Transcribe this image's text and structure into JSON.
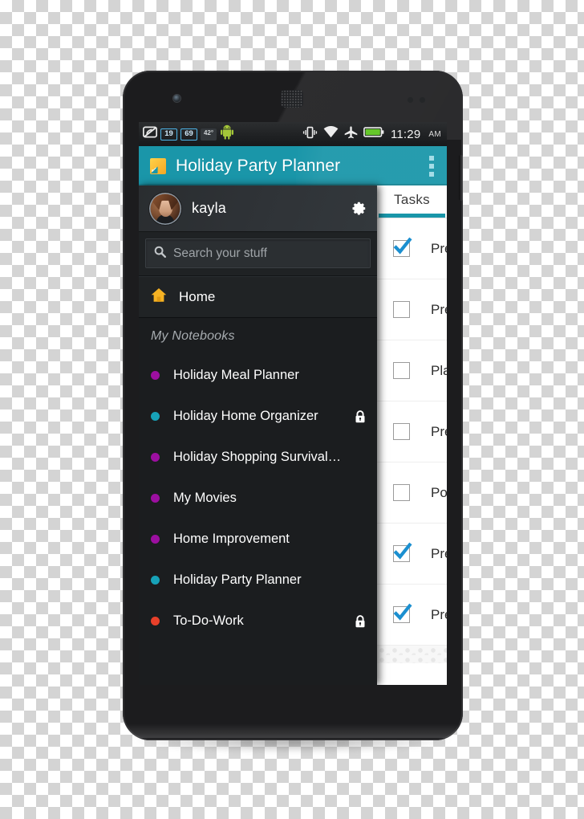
{
  "statusbar": {
    "icons": [
      "vpn-key-icon",
      "signal-badge-19",
      "signal-badge-69",
      "temperature-icon",
      "android-robot-icon",
      "vibrate-icon",
      "wifi-icon",
      "airplane-mode-icon",
      "battery-icon"
    ],
    "badge_19": "19",
    "badge_69": "69",
    "temperature": "42°",
    "time": "11:29",
    "ampm": "AM"
  },
  "appbar": {
    "app_icon": "evernote-notebook-icon",
    "title": "Holiday Party Planner",
    "overflow_label": "overflow-menu"
  },
  "drawer": {
    "account": {
      "avatar": "user-avatar",
      "username": "kayla",
      "settings_icon": "gear-icon"
    },
    "search": {
      "icon": "search-icon",
      "value": "",
      "placeholder": "Search your stuff"
    },
    "home": {
      "icon": "home-icon",
      "label": "Home"
    },
    "section_title": "My Notebooks",
    "notebooks": [
      {
        "label": "Holiday Meal Planner",
        "color": "#9c0fa0",
        "locked": false
      },
      {
        "label": "Holiday Home Organizer",
        "color": "#17a2b8",
        "locked": true
      },
      {
        "label": "Holiday Shopping Survival…",
        "color": "#9c0fa0",
        "locked": false
      },
      {
        "label": "My Movies",
        "color": "#9c0fa0",
        "locked": false
      },
      {
        "label": "Home Improvement",
        "color": "#9c0fa0",
        "locked": false
      },
      {
        "label": "Holiday Party Planner",
        "color": "#17a2b8",
        "locked": false
      },
      {
        "label": "To-Do-Work",
        "color": "#e8402a",
        "locked": true
      }
    ]
  },
  "content": {
    "tab": "Tasks",
    "tasks": [
      {
        "text": "Prep",
        "checked": true
      },
      {
        "text": "Prep",
        "checked": false
      },
      {
        "text": "Plan",
        "checked": false
      },
      {
        "text": "Prep",
        "checked": false
      },
      {
        "text": "Post",
        "checked": false
      },
      {
        "text": "Prep",
        "checked": true
      },
      {
        "text": "Prep",
        "checked": true
      }
    ]
  },
  "colors": {
    "accent_teal": "#1a96a9",
    "drawer_bg": "#1b1d1f",
    "checkbox_blue": "#1b8fd0",
    "app_icon_yellow": "#f5a623"
  },
  "device": {
    "front_camera": "front-camera",
    "earpiece": "earpiece-speaker",
    "power_button": "power-button"
  }
}
